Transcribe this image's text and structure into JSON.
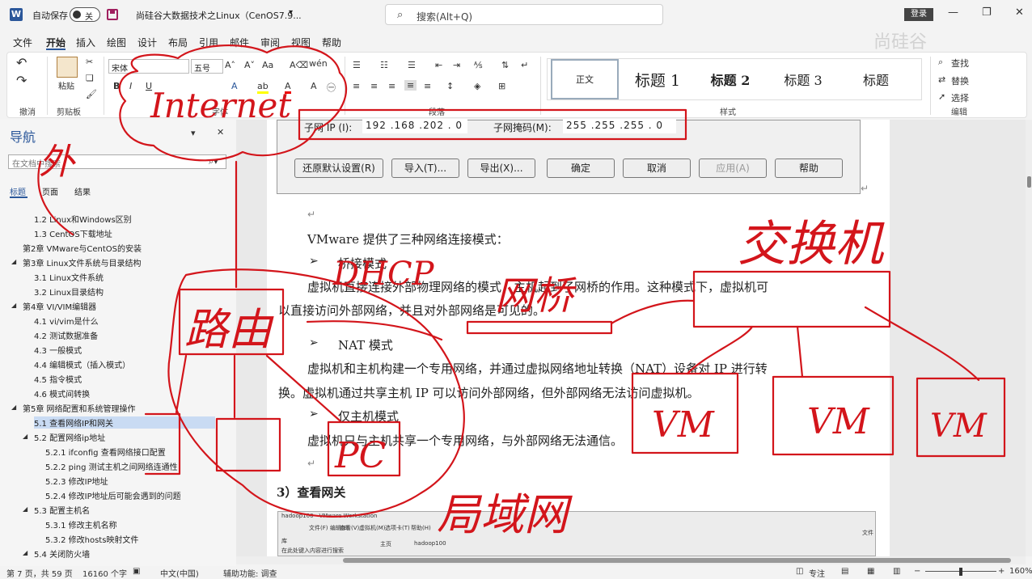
{
  "titlebar": {
    "app_icon": "W",
    "autosave_label": "自动保存",
    "autosave_state": "关",
    "doc_title": "尚硅谷大数据技术之Linux（CenOS7.9...",
    "search_placeholder": "搜索(Alt+Q)",
    "login": "登录",
    "watermark": "尚硅谷"
  },
  "menu": [
    "文件",
    "开始",
    "插入",
    "绘图",
    "设计",
    "布局",
    "引用",
    "邮件",
    "审阅",
    "视图",
    "帮助"
  ],
  "ribbon": {
    "undo_group": "撤消",
    "clipboard_group": "剪贴板",
    "paste": "粘贴",
    "font_group": "字体",
    "font_name": "宋体",
    "font_size": "五号",
    "paragraph_group": "段落",
    "styles_group": "样式",
    "edit_group": "编辑",
    "styles": [
      "正文",
      "标题 1",
      "标题 2",
      "标题 3",
      "标题"
    ],
    "find": "查找",
    "replace": "替换",
    "select": "选择"
  },
  "nav": {
    "title": "导航",
    "search_placeholder": "在文档中搜索",
    "tabs": [
      "标题",
      "页面",
      "结果"
    ],
    "items": [
      "1.2 Linux和Windows区别",
      "1.3 CentOS下载地址",
      "第2章 VMware与CentOS的安装",
      "第3章 Linux文件系统与目录结构",
      "3.1 Linux文件系统",
      "3.2 Linux目录结构",
      "第4章 VI/VIM编辑器",
      "4.1 vi/vim是什么",
      "4.2 测试数据准备",
      "4.3 一般模式",
      "4.4 编辑模式（插入模式）",
      "4.5 指令模式",
      "4.6 模式间转换",
      "第5章 网络配置和系统管理操作",
      "5.1 查看网络IP和网关",
      "5.2 配置网络ip地址",
      "5.2.1 ifconfig 查看网络接口配置",
      "5.2.2 ping 测试主机之间网络连通性",
      "5.2.3 修改IP地址",
      "5.2.4 修改IP地址后可能会遇到的问题",
      "5.3 配置主机名",
      "5.3.1 修改主机名称",
      "5.3.2 修改hosts映射文件",
      "5.4 关闭防火墙"
    ]
  },
  "dialog": {
    "subnet_ip_label": "子网 IP (I):",
    "subnet_ip": "192 .168 .202 . 0",
    "subnet_mask_label": "子网掩码(M):",
    "subnet_mask": "255 .255 .255 . 0",
    "buttons": [
      "还原默认设置(R)",
      "导入(T)...",
      "导出(X)...",
      "确定",
      "取消",
      "应用(A)",
      "帮助"
    ]
  },
  "doc": {
    "intro": "VMware 提供了三种网络连接模式：",
    "mode1_title": "桥接模式",
    "mode1_line1": "虚拟机直接连接外部物理网络的模式，主机起到了网桥的作用。这种模式下，虚拟机可",
    "mode1_line2": "以直接访问外部网络，并且对外部网络是可见的。",
    "mode2_title": "NAT 模式",
    "mode2_line1": "虚拟机和主机构建一个专用网络，并通过虚拟网络地址转换（NAT）设备对 IP 进行转",
    "mode2_line2": "换。虚拟机通过共享主机 IP 可以访问外部网络，但外部网络无法访问虚拟机。",
    "mode3_title": "仅主机模式",
    "mode3_line1": "虚拟机只与主机共享一个专用网络，与外部网络无法通信。",
    "heading3": "3）查看网关",
    "shot_title": "hadoop100 - VMware Workstation",
    "shot_tab1": "主页",
    "shot_tab2": "hadoop100",
    "shot_search": "在此处键入内容进行搜索",
    "shot_menu": [
      "文件(F)",
      "编辑(E)",
      "查看(V)",
      "虚拟机(M)",
      "选项卡(T)",
      "帮助(H)"
    ],
    "shot_side1": "库",
    "shot_side2": "文件"
  },
  "annotations": {
    "internet": "Internet",
    "wai": "外",
    "router": "路由",
    "dhcp": "DHCP",
    "bridge": "网桥",
    "switch": "交换机",
    "vm": "VM",
    "pc": "PC",
    "lan": "局域网"
  },
  "status": {
    "page": "第 7 页，共 59 页",
    "words": "16160 个字",
    "lang": "中文(中国)",
    "a11y": "辅助功能: 调查",
    "focus": "专注",
    "zoom": "160%"
  }
}
